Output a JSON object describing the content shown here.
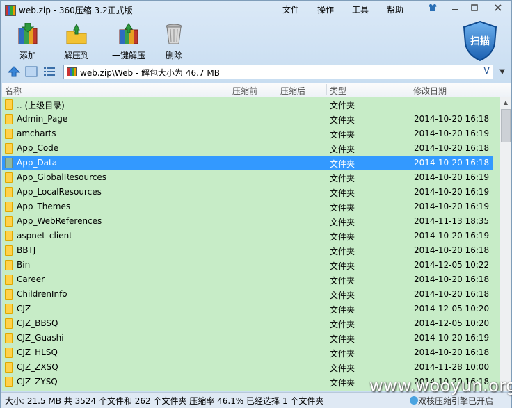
{
  "window": {
    "title": "web.zip - 360压缩 3.2正式版",
    "menus": [
      "文件",
      "操作",
      "工具",
      "帮助"
    ]
  },
  "toolbar": {
    "add_label": "添加",
    "extract_to_label": "解压到",
    "one_click_label": "一键解压",
    "delete_label": "删除",
    "scan_label": "扫描"
  },
  "address": {
    "path": "web.zip\\Web - 解包大小为 46.7 MB",
    "v_icon": "V"
  },
  "columns": {
    "name": "名称",
    "compressed": "压缩前",
    "after": "压缩后",
    "type": "类型",
    "modified": "修改日期"
  },
  "files": [
    {
      "name": ".. (上级目录)",
      "type": "文件夹",
      "date": ""
    },
    {
      "name": "Admin_Page",
      "type": "文件夹",
      "date": "2014-10-20 16:18"
    },
    {
      "name": "amcharts",
      "type": "文件夹",
      "date": "2014-10-20 16:19"
    },
    {
      "name": "App_Code",
      "type": "文件夹",
      "date": "2014-10-20 16:18"
    },
    {
      "name": "App_Data",
      "type": "文件夹",
      "date": "2014-10-20 16:18",
      "selected": true
    },
    {
      "name": "App_GlobalResources",
      "type": "文件夹",
      "date": "2014-10-20 16:19"
    },
    {
      "name": "App_LocalResources",
      "type": "文件夹",
      "date": "2014-10-20 16:19"
    },
    {
      "name": "App_Themes",
      "type": "文件夹",
      "date": "2014-10-20 16:19"
    },
    {
      "name": "App_WebReferences",
      "type": "文件夹",
      "date": "2014-11-13 18:35"
    },
    {
      "name": "aspnet_client",
      "type": "文件夹",
      "date": "2014-10-20 16:19"
    },
    {
      "name": "BBTJ",
      "type": "文件夹",
      "date": "2014-10-20 16:18"
    },
    {
      "name": "Bin",
      "type": "文件夹",
      "date": "2014-12-05 10:22"
    },
    {
      "name": "Career",
      "type": "文件夹",
      "date": "2014-10-20 16:18"
    },
    {
      "name": "ChildrenInfo",
      "type": "文件夹",
      "date": "2014-10-20 16:18"
    },
    {
      "name": "CJZ",
      "type": "文件夹",
      "date": "2014-12-05 10:20"
    },
    {
      "name": "CJZ_BBSQ",
      "type": "文件夹",
      "date": "2014-12-05 10:20"
    },
    {
      "name": "CJZ_Guashi",
      "type": "文件夹",
      "date": "2014-10-20 16:19"
    },
    {
      "name": "CJZ_HLSQ",
      "type": "文件夹",
      "date": "2014-10-20 16:18"
    },
    {
      "name": "CJZ_ZXSQ",
      "type": "文件夹",
      "date": "2014-11-28 10:00"
    },
    {
      "name": "CJZ_ZYSQ",
      "type": "文件夹",
      "date": "2014-10-20 16:18"
    }
  ],
  "status": {
    "text": "大小: 21.5 MB 共 3524 个文件和 262 个文件夹 压缩率 46.1% 已经选择 1 个文件夹",
    "badge": "双核压缩引擎已开启"
  },
  "watermark": "www.wooyun.org"
}
